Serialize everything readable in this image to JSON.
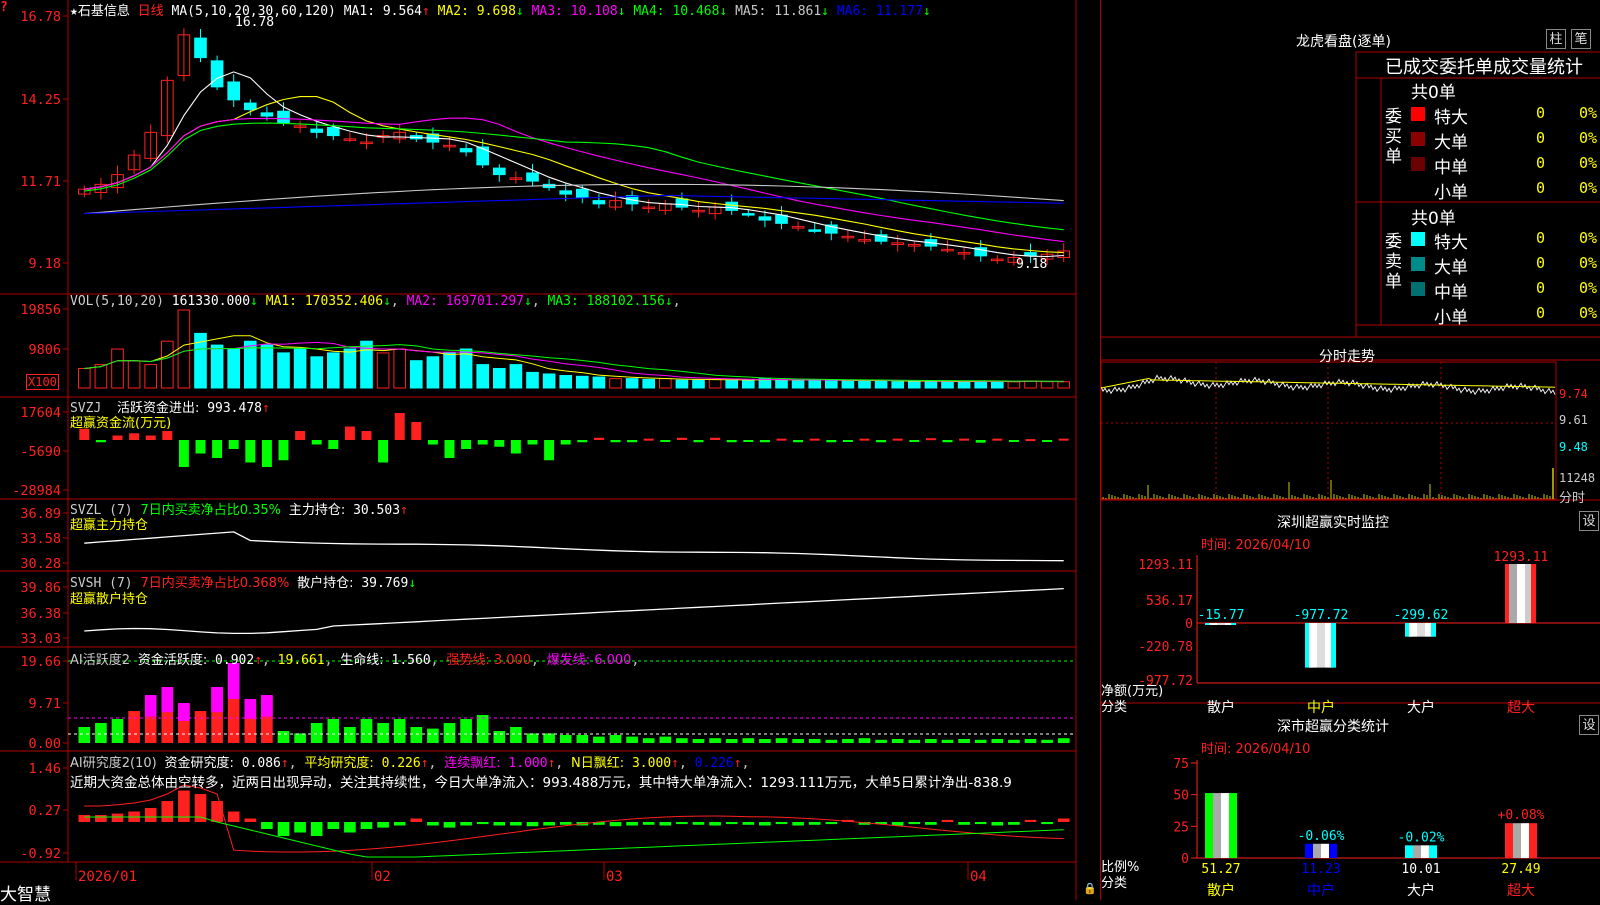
{
  "app": {
    "brand": "大智慧",
    "lock_icon": "lock-icon"
  },
  "main_chart": {
    "star": "★",
    "name": "石基信息",
    "period": "日线",
    "ma_params": "MA(5,10,20,30,60,120)",
    "ma": [
      {
        "label": "MA1:",
        "value": "9.564",
        "arrow": "↑",
        "color": "#ffffff"
      },
      {
        "label": "MA2:",
        "value": "9.698",
        "arrow": "↓",
        "color": "#ffff00"
      },
      {
        "label": "MA3:",
        "value": "10.108",
        "arrow": "↓",
        "color": "#ff00ff"
      },
      {
        "label": "MA4:",
        "value": "10.468",
        "arrow": "↓",
        "color": "#00ff00"
      },
      {
        "label": "MA5:",
        "value": "11.861",
        "arrow": "↓",
        "color": "#c8c8c8"
      },
      {
        "label": "MA6:",
        "value": "11.177",
        "arrow": "↓",
        "color": "#0000ff"
      }
    ],
    "y_ticks": [
      "16.78",
      "14.25",
      "11.71",
      "9.18"
    ],
    "high_label": "16.78",
    "low_label": "9.18",
    "corner": "?"
  },
  "vol": {
    "params": "VOL(5,10,20)",
    "value": "161330.000",
    "value_arrow": "↓",
    "ma": [
      {
        "label": "MA1:",
        "value": "170352.406",
        "arrow": "↓",
        "color": "#ffff00"
      },
      {
        "label": "MA2:",
        "value": "169701.297",
        "arrow": "↓",
        "color": "#ff00ff"
      },
      {
        "label": "MA3:",
        "value": "188102.156",
        "arrow": "↓",
        "color": "#00ff00"
      }
    ],
    "y_ticks": [
      "19856",
      "9806"
    ],
    "unit": "X100"
  },
  "svzj": {
    "title": "SVZJ",
    "line1_label": "活跃资金进出:",
    "line1_value": "993.478",
    "line1_arrow": "↑",
    "line2": "超赢资金流(万元)",
    "y_ticks": [
      "17604",
      "-5690",
      "-28984"
    ]
  },
  "svzl": {
    "title": "SVZL (7)",
    "desc": "7日内买卖净占比0.35%",
    "hold_label": "主力持仓:",
    "hold_value": "30.503",
    "hold_arrow": "↑",
    "line2": "超赢主力持仓",
    "y_ticks": [
      "36.89",
      "33.58",
      "30.28"
    ]
  },
  "svsh": {
    "title": "SVSH (7)",
    "desc": "7日内买卖净占比0.368%",
    "hold_label": "散户持仓:",
    "hold_value": "39.769",
    "hold_arrow": "↓",
    "line2": "超赢散户持仓",
    "y_ticks": [
      "39.86",
      "36.38",
      "33.03"
    ]
  },
  "ai_active": {
    "title": "AI活跃度2",
    "label1": "资金活跃度:",
    "value1": "0.902",
    "value1_arrow": "↑",
    "value2": "19.661",
    "label3": "生命线:",
    "value3": "1.560",
    "strong": "强势线: 3.000",
    "burst": "爆发线: 6.000",
    "y_ticks": [
      "19.66",
      "9.71",
      "0.00"
    ]
  },
  "ai_research": {
    "title": "AI研究度2(10)",
    "label1": "资金研究度:",
    "value1": "0.086",
    "label2": "平均研究度:",
    "value2": "0.226",
    "label3": "连续飘红:",
    "value3": "1.000",
    "label4": "N日飘红:",
    "value4": "3.000",
    "value5": "0.226",
    "comment": "近期大资金总体由空转多，近两日出现异动，关注其持续性，今日大单净流入：993.488万元，其中特大单净流入：1293.111万元，大单5日累计净出-838.9",
    "y_ticks": [
      "1.46",
      "0.27",
      "-0.92"
    ]
  },
  "x_axis": [
    "2026/01",
    "02",
    "03",
    "04"
  ],
  "dragon": {
    "title": "龙虎看盘(逐单)",
    "btn_pillar": "柱",
    "btn_pen": "笔",
    "subtitle": "已成交委托单成交量统计",
    "buy": {
      "label": "委买单",
      "total": "共0单",
      "rows": [
        {
          "name": "特大",
          "count": "0",
          "pct": "0%",
          "color": "#ff0000"
        },
        {
          "name": "大单",
          "count": "0",
          "pct": "0%",
          "color": "#8b0000"
        },
        {
          "name": "中单",
          "count": "0",
          "pct": "0%",
          "color": "#6a0000"
        },
        {
          "name": "小单",
          "count": "0",
          "pct": "0%",
          "color": ""
        }
      ]
    },
    "sell": {
      "label": "委卖单",
      "total": "共0单",
      "rows": [
        {
          "name": "特大",
          "count": "0",
          "pct": "0%",
          "color": "#00ffff"
        },
        {
          "name": "大单",
          "count": "0",
          "pct": "0%",
          "color": "#008b8b"
        },
        {
          "name": "中单",
          "count": "0",
          "pct": "0%",
          "color": "#007070"
        },
        {
          "name": "小单",
          "count": "0",
          "pct": "0%",
          "color": ""
        }
      ]
    }
  },
  "intraday": {
    "title": "分时走势",
    "ticks": [
      "9.74",
      "9.61",
      "9.48",
      "11248"
    ],
    "bottom_label": "分时"
  },
  "monitor": {
    "title": "深圳超赢实时监控",
    "settings": "设",
    "time": "时间: 2026/04/10",
    "y_ticks": [
      "1293.11",
      "536.17",
      "0",
      "-220.78",
      "-977.72"
    ],
    "y_label": "净额(万元)",
    "x_label": "分类",
    "cats": [
      "散户",
      "中户",
      "大户",
      "超大"
    ],
    "values": [
      -15.77,
      -977.72,
      -299.62,
      1293.11
    ],
    "value_labels": [
      "-15.77",
      "-977.72",
      "-299.62",
      "1293.11"
    ]
  },
  "classify": {
    "title": "深市超赢分类统计",
    "settings": "设",
    "time": "时间: 2026/04/10",
    "y_ticks": [
      "75",
      "50",
      "25",
      "0"
    ],
    "y_label": "比例%",
    "x_label": "分类",
    "cats": [
      "散户",
      "中户",
      "大户",
      "超大"
    ],
    "values": [
      51.27,
      11.23,
      10.01,
      27.49
    ],
    "value_labels": [
      "51.27",
      "11.23",
      "10.01",
      "27.49"
    ],
    "deltas": [
      "",
      "-0.06%",
      "-0.02%",
      "+0.08%"
    ]
  }
}
